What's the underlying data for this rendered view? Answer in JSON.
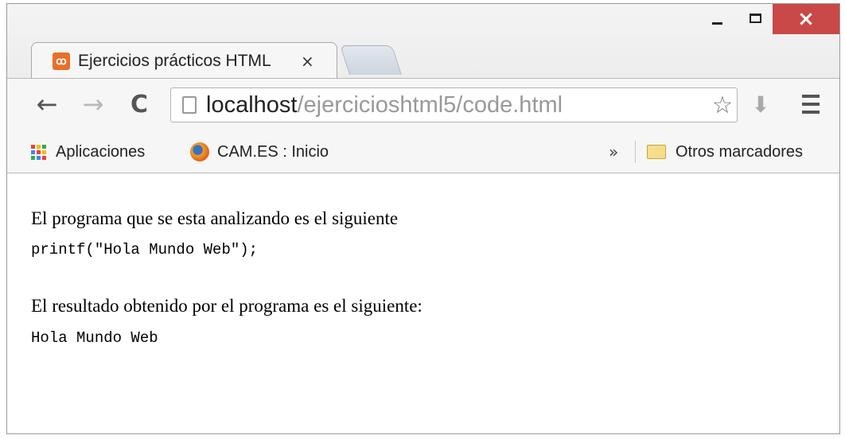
{
  "window": {
    "controls": {
      "minimize": "minimize",
      "maximize": "maximize",
      "close": "×"
    }
  },
  "tabs": [
    {
      "title": "Ejercicios prácticos HTML",
      "close": "×"
    }
  ],
  "toolbar": {
    "url_host": "localhost",
    "url_path": "/ejercicioshtml5/code.html"
  },
  "bookmarks": {
    "items": [
      {
        "label": "Aplicaciones",
        "icon": "apps-grid-icon"
      },
      {
        "label": "CAM.ES : Inicio",
        "icon": "cam-favicon"
      }
    ],
    "more": "»",
    "other": "Otros marcadores"
  },
  "content": {
    "line1": "El programa que se esta analizando es el siguiente",
    "code1": "printf(\"Hola Mundo Web\");",
    "line2": "El resultado obtenido por el programa es el siguiente:",
    "code2": "Hola Mundo Web"
  },
  "colors": {
    "close_button": "#c94848",
    "favicon": "#e8702a",
    "url_host": "#222222",
    "url_path": "#999999"
  }
}
